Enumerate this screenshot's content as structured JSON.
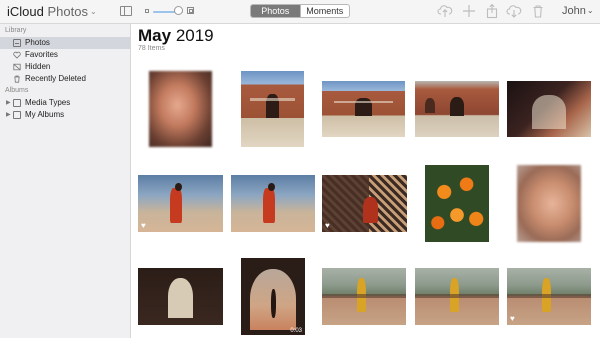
{
  "app": {
    "brand": "iCloud",
    "name": "Photos"
  },
  "toolbar": {
    "segments": [
      "Photos",
      "Moments"
    ],
    "active_segment": "Photos",
    "user": "John",
    "icons": [
      "sidebar-toggle-icon",
      "upload-icon",
      "add-icon",
      "share-icon",
      "download-icon",
      "trash-icon"
    ]
  },
  "sidebar": {
    "library_title": "Library",
    "library_items": [
      {
        "label": "Photos",
        "icon": "photos-icon",
        "selected": true
      },
      {
        "label": "Favorites",
        "icon": "heart-icon"
      },
      {
        "label": "Hidden",
        "icon": "hidden-icon"
      },
      {
        "label": "Recently Deleted",
        "icon": "trash-icon"
      }
    ],
    "albums_title": "Albums",
    "album_items": [
      {
        "label": "Media Types",
        "icon": "folder-icon"
      },
      {
        "label": "My Albums",
        "icon": "folder-icon"
      }
    ]
  },
  "main": {
    "month": "May",
    "year": "2019",
    "count": "78 Items",
    "video_duration": "0:03"
  },
  "colors": {
    "accent": "#7a7a7a",
    "selection": "#d3d6dc",
    "sidebar_bg": "#f0f0f2"
  }
}
